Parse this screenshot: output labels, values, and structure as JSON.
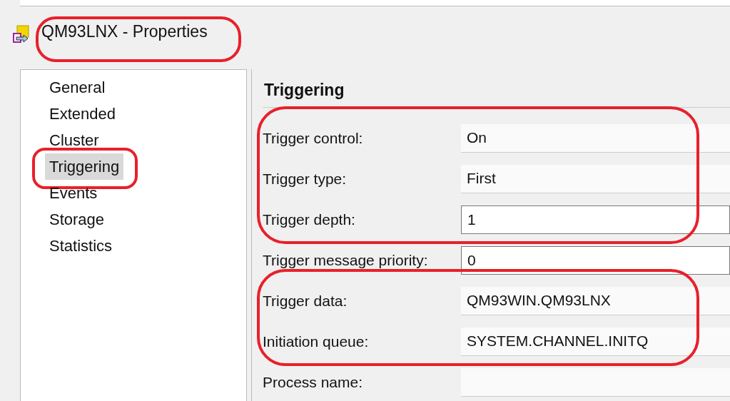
{
  "window": {
    "title": "QM93LNX - Properties",
    "circled": true
  },
  "sidebar": {
    "items": [
      {
        "label": "General",
        "selected": false,
        "circled": false
      },
      {
        "label": "Extended",
        "selected": false,
        "circled": false
      },
      {
        "label": "Cluster",
        "selected": false,
        "circled": false
      },
      {
        "label": "Triggering",
        "selected": true,
        "circled": true
      },
      {
        "label": "Events",
        "selected": false,
        "circled": false
      },
      {
        "label": "Storage",
        "selected": false,
        "circled": false
      },
      {
        "label": "Statistics",
        "selected": false,
        "circled": false
      }
    ]
  },
  "panel": {
    "heading": "Triggering",
    "fields": [
      {
        "label": "Trigger control:",
        "value": "On",
        "editable": false,
        "circled": true
      },
      {
        "label": "Trigger type:",
        "value": "First",
        "editable": false,
        "circled": true
      },
      {
        "label": "Trigger depth:",
        "value": "1",
        "editable": true,
        "circled": true
      },
      {
        "label": "Trigger message priority:",
        "value": "0",
        "editable": true,
        "circled": false
      },
      {
        "label": "Trigger data:",
        "value": "QM93WIN.QM93LNX",
        "editable": false,
        "circled": true
      },
      {
        "label": "Initiation queue:",
        "value": "SYSTEM.CHANNEL.INITQ",
        "editable": false,
        "circled": true
      },
      {
        "label": "Process name:",
        "editable": false,
        "circled": false
      }
    ]
  }
}
